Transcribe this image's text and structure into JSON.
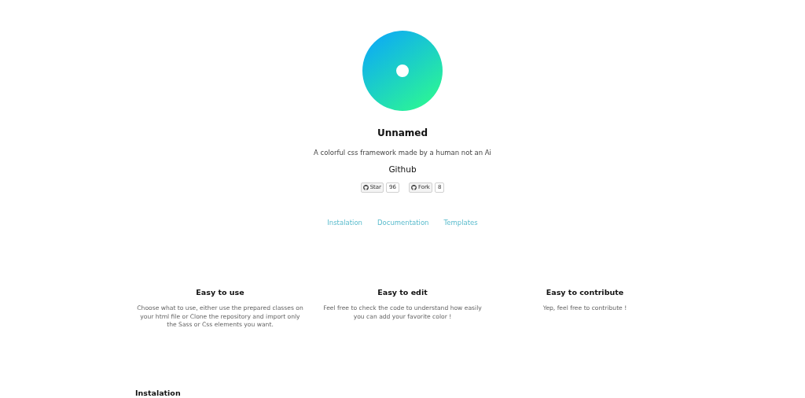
{
  "header": {
    "title": "Unnamed",
    "tagline": "A colorful css framework made by a human not an Ai",
    "github_heading": "Github",
    "badges": [
      {
        "label": "Star",
        "count": "96"
      },
      {
        "label": "Fork",
        "count": "8"
      }
    ]
  },
  "nav": [
    {
      "label": "Instalation"
    },
    {
      "label": "Documentation"
    },
    {
      "label": "Templates"
    }
  ],
  "features": [
    {
      "title": "Easy to use",
      "text": "Choose what to use, either use the prepared classes on your html file or Clone the repository and import only the Sass or Css elements you want."
    },
    {
      "title": "Easy to edit",
      "text": "Feel free to check the code to understand how easily you can add your favorite color !"
    },
    {
      "title": "Easy to contribute",
      "text": "Yep, feel free to contribute !"
    }
  ],
  "section_heading": "Instalation"
}
